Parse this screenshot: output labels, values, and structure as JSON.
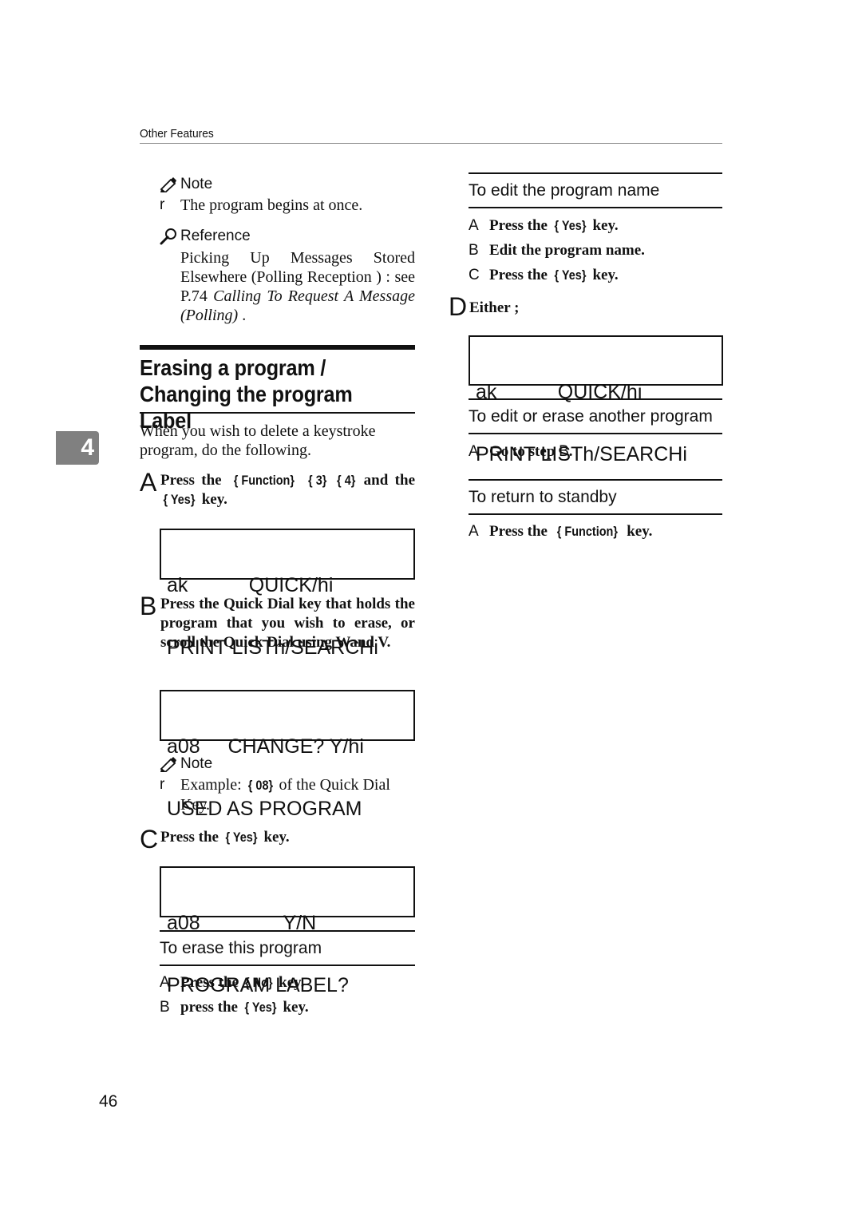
{
  "header": {
    "running_head": "Other Features"
  },
  "left": {
    "note1": {
      "heading": "Note",
      "bullet_marker": "r",
      "items": [
        "The program begins at once."
      ]
    },
    "reference": {
      "heading": "Reference",
      "text_plain": "Picking Up Messages Stored Elsewhere (Polling Reception ) : see P.74 ",
      "text_italic": "Calling To Request A Message (Polling)",
      "text_end": " ."
    },
    "section": {
      "title": "Erasing a program / Changing the program Label",
      "intro": "When you wish to delete a keystroke program, do the following."
    },
    "chapter_tab": "4",
    "step_a": {
      "letter": "A",
      "pre": "Press the ",
      "k1": "{ Function}",
      "k2": "{ 3}",
      "k3": "{ 4}",
      "mid": " and the ",
      "k4": "{ Yes}",
      "post": " key."
    },
    "lcd1": {
      "line1": "ak           QUICK/hi",
      "line2": "PRINT LISTh/SEARCHi"
    },
    "step_b": {
      "letter": "B",
      "text": "Press the Quick Dial key that holds the program that you wish to erase, or scroll the Quick Dial using Wand V."
    },
    "lcd2": {
      "line1": "a08     CHANGE? Y/hi",
      "line2": "USED AS PROGRAM"
    },
    "note2": {
      "heading": "Note",
      "bullet_marker": "r",
      "pre": "Example: ",
      "key": "{ 08}",
      "post": " of the Quick Dial Key."
    },
    "step_c": {
      "letter": "C",
      "pre": "Press the ",
      "key": "{ Yes}",
      "post": " key."
    },
    "lcd3": {
      "line1": "a08               Y/N",
      "line2": "PROGRAM LABEL?"
    },
    "erase": {
      "heading": "To erase this program",
      "steps": [
        {
          "letter": "A",
          "pre": "Press the ",
          "key": "{ No}",
          "post": " key."
        },
        {
          "letter": "B",
          "pre": "press the ",
          "key": "{ Yes}",
          "post": " key."
        }
      ]
    }
  },
  "right": {
    "edit_name": {
      "heading": "To edit the program name",
      "steps": [
        {
          "letter": "A",
          "pre": "Press the ",
          "key": "{ Yes}",
          "post": " key."
        },
        {
          "letter": "B",
          "pre": "Edit the program name.",
          "key": "",
          "post": ""
        },
        {
          "letter": "C",
          "pre": "Press the ",
          "key": "{ Yes}",
          "post": " key."
        }
      ]
    },
    "step_d": {
      "letter": "D",
      "text": "Either ;"
    },
    "lcd4": {
      "line1": "ak           QUICK/hi",
      "line2": "PRINT LISTh/SEARCHi"
    },
    "edit_another": {
      "heading": "To edit or erase another program",
      "steps": [
        {
          "letter": "A",
          "pre": "Go to step ",
          "key": "B",
          "post": "."
        }
      ]
    },
    "standby": {
      "heading": "To return to standby",
      "steps": [
        {
          "letter": "A",
          "pre": "Press the ",
          "key": "{ Function}",
          "post": " key."
        }
      ]
    }
  },
  "footer": {
    "page_number": "46"
  }
}
